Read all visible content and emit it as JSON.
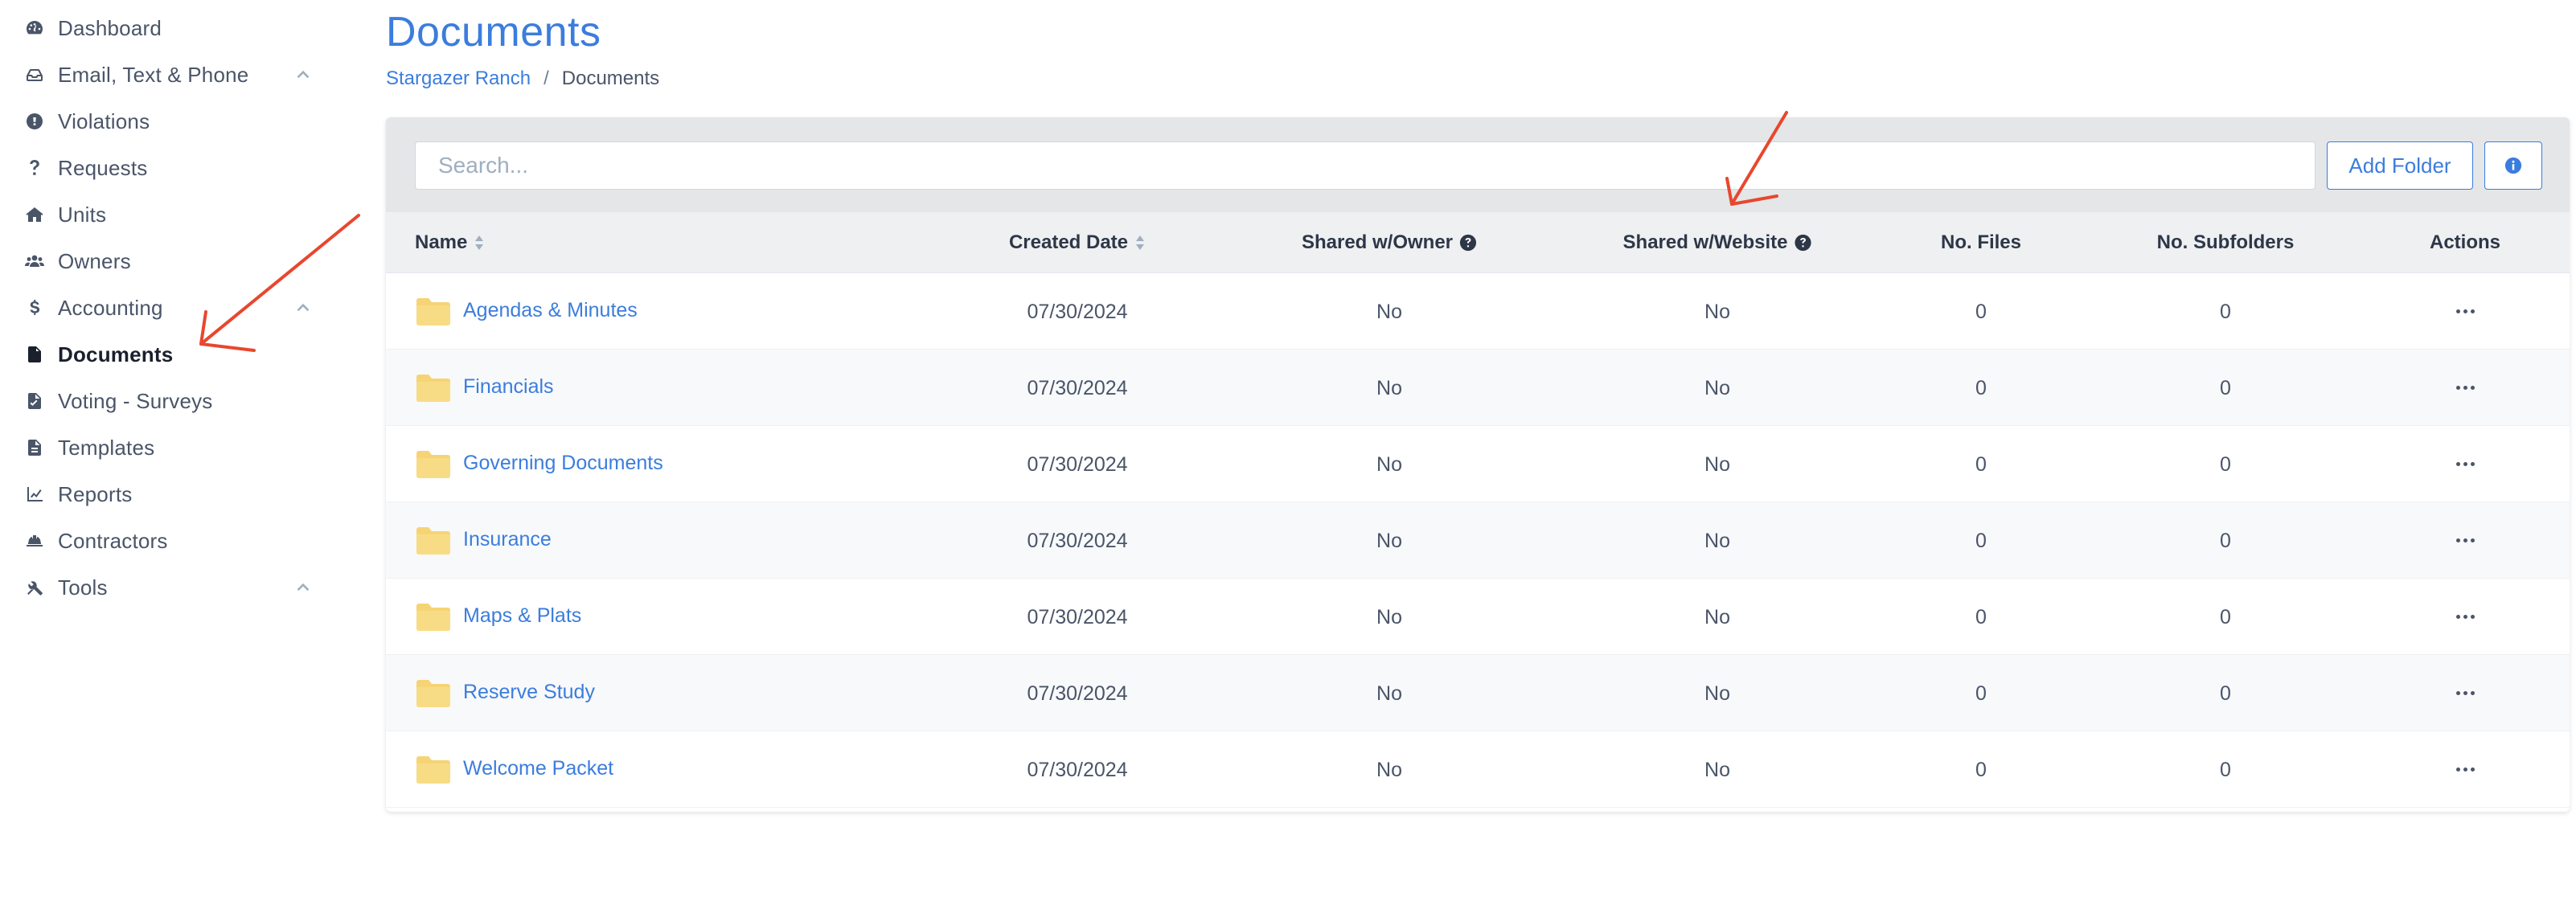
{
  "sidebar": {
    "items": [
      {
        "label": "Dashboard",
        "icon": "tachometer-icon"
      },
      {
        "label": "Email, Text & Phone",
        "icon": "inbox-icon"
      },
      {
        "label": "Violations",
        "icon": "exclamation-circle-icon"
      },
      {
        "label": "Requests",
        "icon": "question-icon"
      },
      {
        "label": "Units",
        "icon": "home-icon"
      },
      {
        "label": "Owners",
        "icon": "users-icon"
      },
      {
        "label": "Accounting",
        "icon": "dollar-icon"
      },
      {
        "label": "Documents",
        "icon": "file-icon"
      },
      {
        "label": "Voting - Surveys",
        "icon": "file-vote-icon"
      },
      {
        "label": "Templates",
        "icon": "file-alt-icon"
      },
      {
        "label": "Reports",
        "icon": "chart-line-icon"
      },
      {
        "label": "Contractors",
        "icon": "hard-hat-icon"
      },
      {
        "label": "Tools",
        "icon": "tools-icon"
      }
    ]
  },
  "header": {
    "title": "Documents",
    "breadcrumb": {
      "parent": "Stargazer Ranch",
      "separator": "/",
      "current": "Documents"
    }
  },
  "toolbar": {
    "search_placeholder": "Search...",
    "add_folder_label": "Add Folder"
  },
  "table": {
    "columns": {
      "name": "Name",
      "created_date": "Created Date",
      "shared_owner": "Shared w/Owner",
      "shared_website": "Shared w/Website",
      "no_files": "No. Files",
      "no_subfolders": "No. Subfolders",
      "actions": "Actions"
    },
    "rows": [
      {
        "name": "Agendas & Minutes",
        "created": "07/30/2024",
        "shared_owner": "No",
        "shared_website": "No",
        "files": "0",
        "subfolders": "0"
      },
      {
        "name": "Financials",
        "created": "07/30/2024",
        "shared_owner": "No",
        "shared_website": "No",
        "files": "0",
        "subfolders": "0"
      },
      {
        "name": "Governing Documents",
        "created": "07/30/2024",
        "shared_owner": "No",
        "shared_website": "No",
        "files": "0",
        "subfolders": "0"
      },
      {
        "name": "Insurance",
        "created": "07/30/2024",
        "shared_owner": "No",
        "shared_website": "No",
        "files": "0",
        "subfolders": "0"
      },
      {
        "name": "Maps & Plats",
        "created": "07/30/2024",
        "shared_owner": "No",
        "shared_website": "No",
        "files": "0",
        "subfolders": "0"
      },
      {
        "name": "Reserve Study",
        "created": "07/30/2024",
        "shared_owner": "No",
        "shared_website": "No",
        "files": "0",
        "subfolders": "0"
      },
      {
        "name": "Welcome Packet",
        "created": "07/30/2024",
        "shared_owner": "No",
        "shared_website": "No",
        "files": "0",
        "subfolders": "0"
      }
    ]
  },
  "colors": {
    "accent": "#3b7ddd",
    "folder": "#f6d475",
    "annotation_arrow": "#e8472e"
  }
}
